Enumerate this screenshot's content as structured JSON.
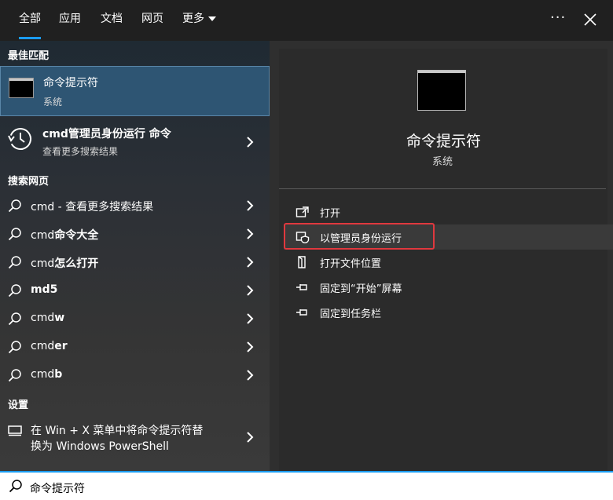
{
  "tabs": {
    "all": "全部",
    "apps": "应用",
    "docs": "文档",
    "web": "网页",
    "more": "更多"
  },
  "header": {
    "more_options": "···"
  },
  "left": {
    "best_match_label": "最佳匹配",
    "best_match": {
      "title": "命令提示符",
      "subtitle": "系统"
    },
    "history_item": {
      "title": "cmd管理员身份运行 命令",
      "subtitle": "查看更多搜索结果"
    },
    "web_label": "搜索网页",
    "web_results": [
      {
        "prefix": "cmd",
        "suffix": " - 查看更多搜索结果"
      },
      {
        "prefix": "cmd",
        "suffix": "命令大全"
      },
      {
        "prefix": "cmd",
        "suffix": "怎么打开"
      },
      {
        "prefix": "",
        "suffix": "md5"
      },
      {
        "prefix": "cmd",
        "suffix": "w"
      },
      {
        "prefix": "cmd",
        "suffix": "er"
      },
      {
        "prefix": "cmd",
        "suffix": "b"
      }
    ],
    "settings_label": "设置",
    "settings_item": {
      "line1": "在 Win + X 菜单中将命令提示符替",
      "line2": "换为 Windows PowerShell"
    }
  },
  "detail": {
    "title": "命令提示符",
    "subtitle": "系统",
    "actions": [
      {
        "label": "打开",
        "icon": "open-icon"
      },
      {
        "label": "以管理员身份运行",
        "icon": "shield-icon"
      },
      {
        "label": "打开文件位置",
        "icon": "file-location-icon"
      },
      {
        "label": "固定到“开始”屏幕",
        "icon": "pin-icon"
      },
      {
        "label": "固定到任务栏",
        "icon": "pin-icon"
      }
    ]
  },
  "search": {
    "query": "命令提示符"
  },
  "colors": {
    "accent": "#1a9bf0",
    "selection": "#2e5573",
    "highlight_box": "#e0383e"
  }
}
